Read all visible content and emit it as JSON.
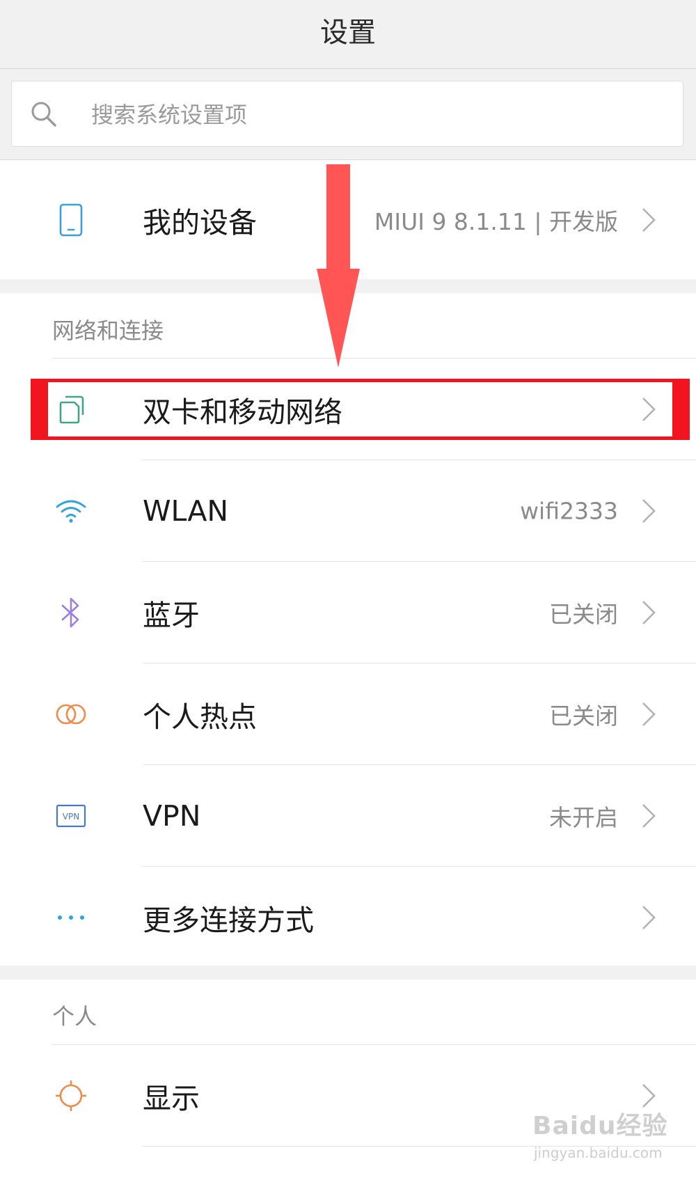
{
  "header": {
    "title": "设置"
  },
  "search": {
    "placeholder": "搜索系统设置项"
  },
  "device": {
    "label": "我的设备",
    "value": "MIUI 9 8.1.11 | 开发版"
  },
  "sections": {
    "network": {
      "title": "网络和连接",
      "items": [
        {
          "label": "双卡和移动网络",
          "value": ""
        },
        {
          "label": "WLAN",
          "value": "wifi2333"
        },
        {
          "label": "蓝牙",
          "value": "已关闭"
        },
        {
          "label": "个人热点",
          "value": "已关闭"
        },
        {
          "label": "VPN",
          "value": "未开启"
        },
        {
          "label": "更多连接方式",
          "value": ""
        }
      ]
    },
    "personal": {
      "title": "个人",
      "items": [
        {
          "label": "显示",
          "value": ""
        }
      ]
    }
  },
  "icons": {
    "device": "phone-icon",
    "sim": "dual-sim-icon",
    "wlan": "wifi-icon",
    "bluetooth": "bluetooth-icon",
    "hotspot": "hotspot-icon",
    "vpn": "vpn-icon",
    "vpn_badge_text": "VPN",
    "more": "more-dots-icon",
    "display": "brightness-icon"
  },
  "watermark": {
    "brand": "Baidu经验",
    "url": "jingyan.baidu.com"
  },
  "colors": {
    "annotation_red": "#f2141f",
    "arrow_red": "#ff5555",
    "device_icon": "#3aa0d8",
    "sim_icon": "#3ea58a",
    "wifi_icon": "#2ea3dc",
    "bluetooth_icon": "#9b7fe0",
    "hotspot_icon": "#f08a4b",
    "vpn_icon": "#4a78c8",
    "more_icon": "#2ea3dc",
    "display_icon": "#f08a4b"
  }
}
